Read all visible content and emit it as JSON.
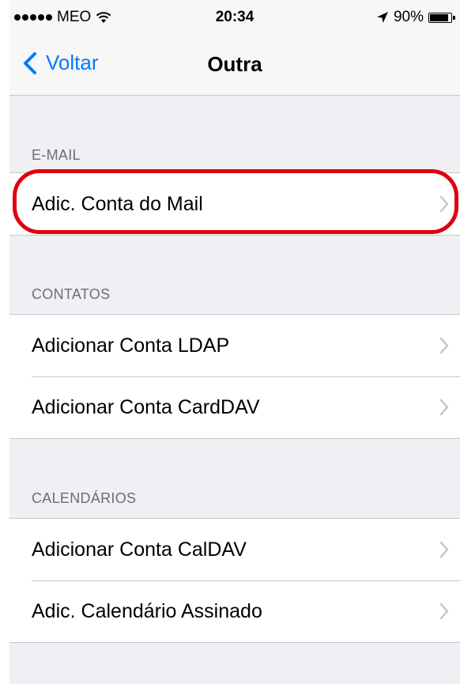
{
  "status_bar": {
    "carrier": "MEO",
    "time": "20:34",
    "battery_percent": "90%",
    "battery_level": 0.9,
    "icons": [
      "signal-dots-icon",
      "wifi-icon",
      "location-arrow-icon",
      "battery-icon"
    ]
  },
  "nav": {
    "back_label": "Voltar",
    "title": "Outra",
    "accent_color": "#007aff"
  },
  "sections": [
    {
      "header": "E-MAIL",
      "rows": [
        {
          "label": "Adic. Conta do Mail"
        }
      ]
    },
    {
      "header": "CONTATOS",
      "rows": [
        {
          "label": "Adicionar Conta LDAP"
        },
        {
          "label": "Adicionar Conta CardDAV"
        }
      ]
    },
    {
      "header": "CALENDÁRIOS",
      "rows": [
        {
          "label": "Adicionar Conta CalDAV"
        },
        {
          "label": "Adic. Calendário Assinado"
        }
      ]
    }
  ],
  "annotation": {
    "highlight_color": "#e0000e"
  }
}
